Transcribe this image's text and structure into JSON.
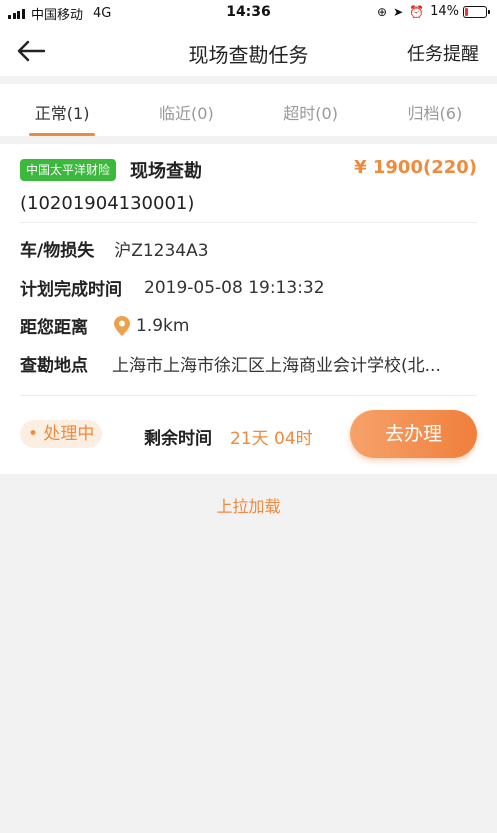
{
  "status_bar": {
    "carrier": "中国移动",
    "network": "4G",
    "time": "14:36",
    "battery": "14%",
    "battery_level": 0.14
  },
  "nav": {
    "title": "现场查勘任务",
    "action": "任务提醒"
  },
  "tabs": [
    {
      "label": "正常(1)",
      "active": true
    },
    {
      "label": "临近(0)",
      "active": false
    },
    {
      "label": "超时(0)",
      "active": false
    },
    {
      "label": "归档(6)",
      "active": false
    }
  ],
  "task": {
    "company": "中国太平洋财险",
    "type": "现场查勘",
    "price": "¥ 1900(220)",
    "case_no": "(10201904130001)",
    "vehicle_label": "车/物损失",
    "vehicle_value": "沪Z1234A3",
    "deadline_label": "计划完成时间",
    "deadline_value": "2019-05-08 19:13:32",
    "distance_label": "距您距离",
    "distance_value": "1.9km",
    "address_label": "查勘地点",
    "address_value": "上海市上海市徐汇区上海商业会计学校(北...",
    "status": "• 处理中",
    "remaining_label": "剩余时间",
    "remaining_value": "21天 04时",
    "action_label": "去办理"
  },
  "load_more": "上拉加载",
  "colors": {
    "accent": "#f08a3c",
    "badge_green": "#3cb93c",
    "background": "#f2f2f2"
  }
}
